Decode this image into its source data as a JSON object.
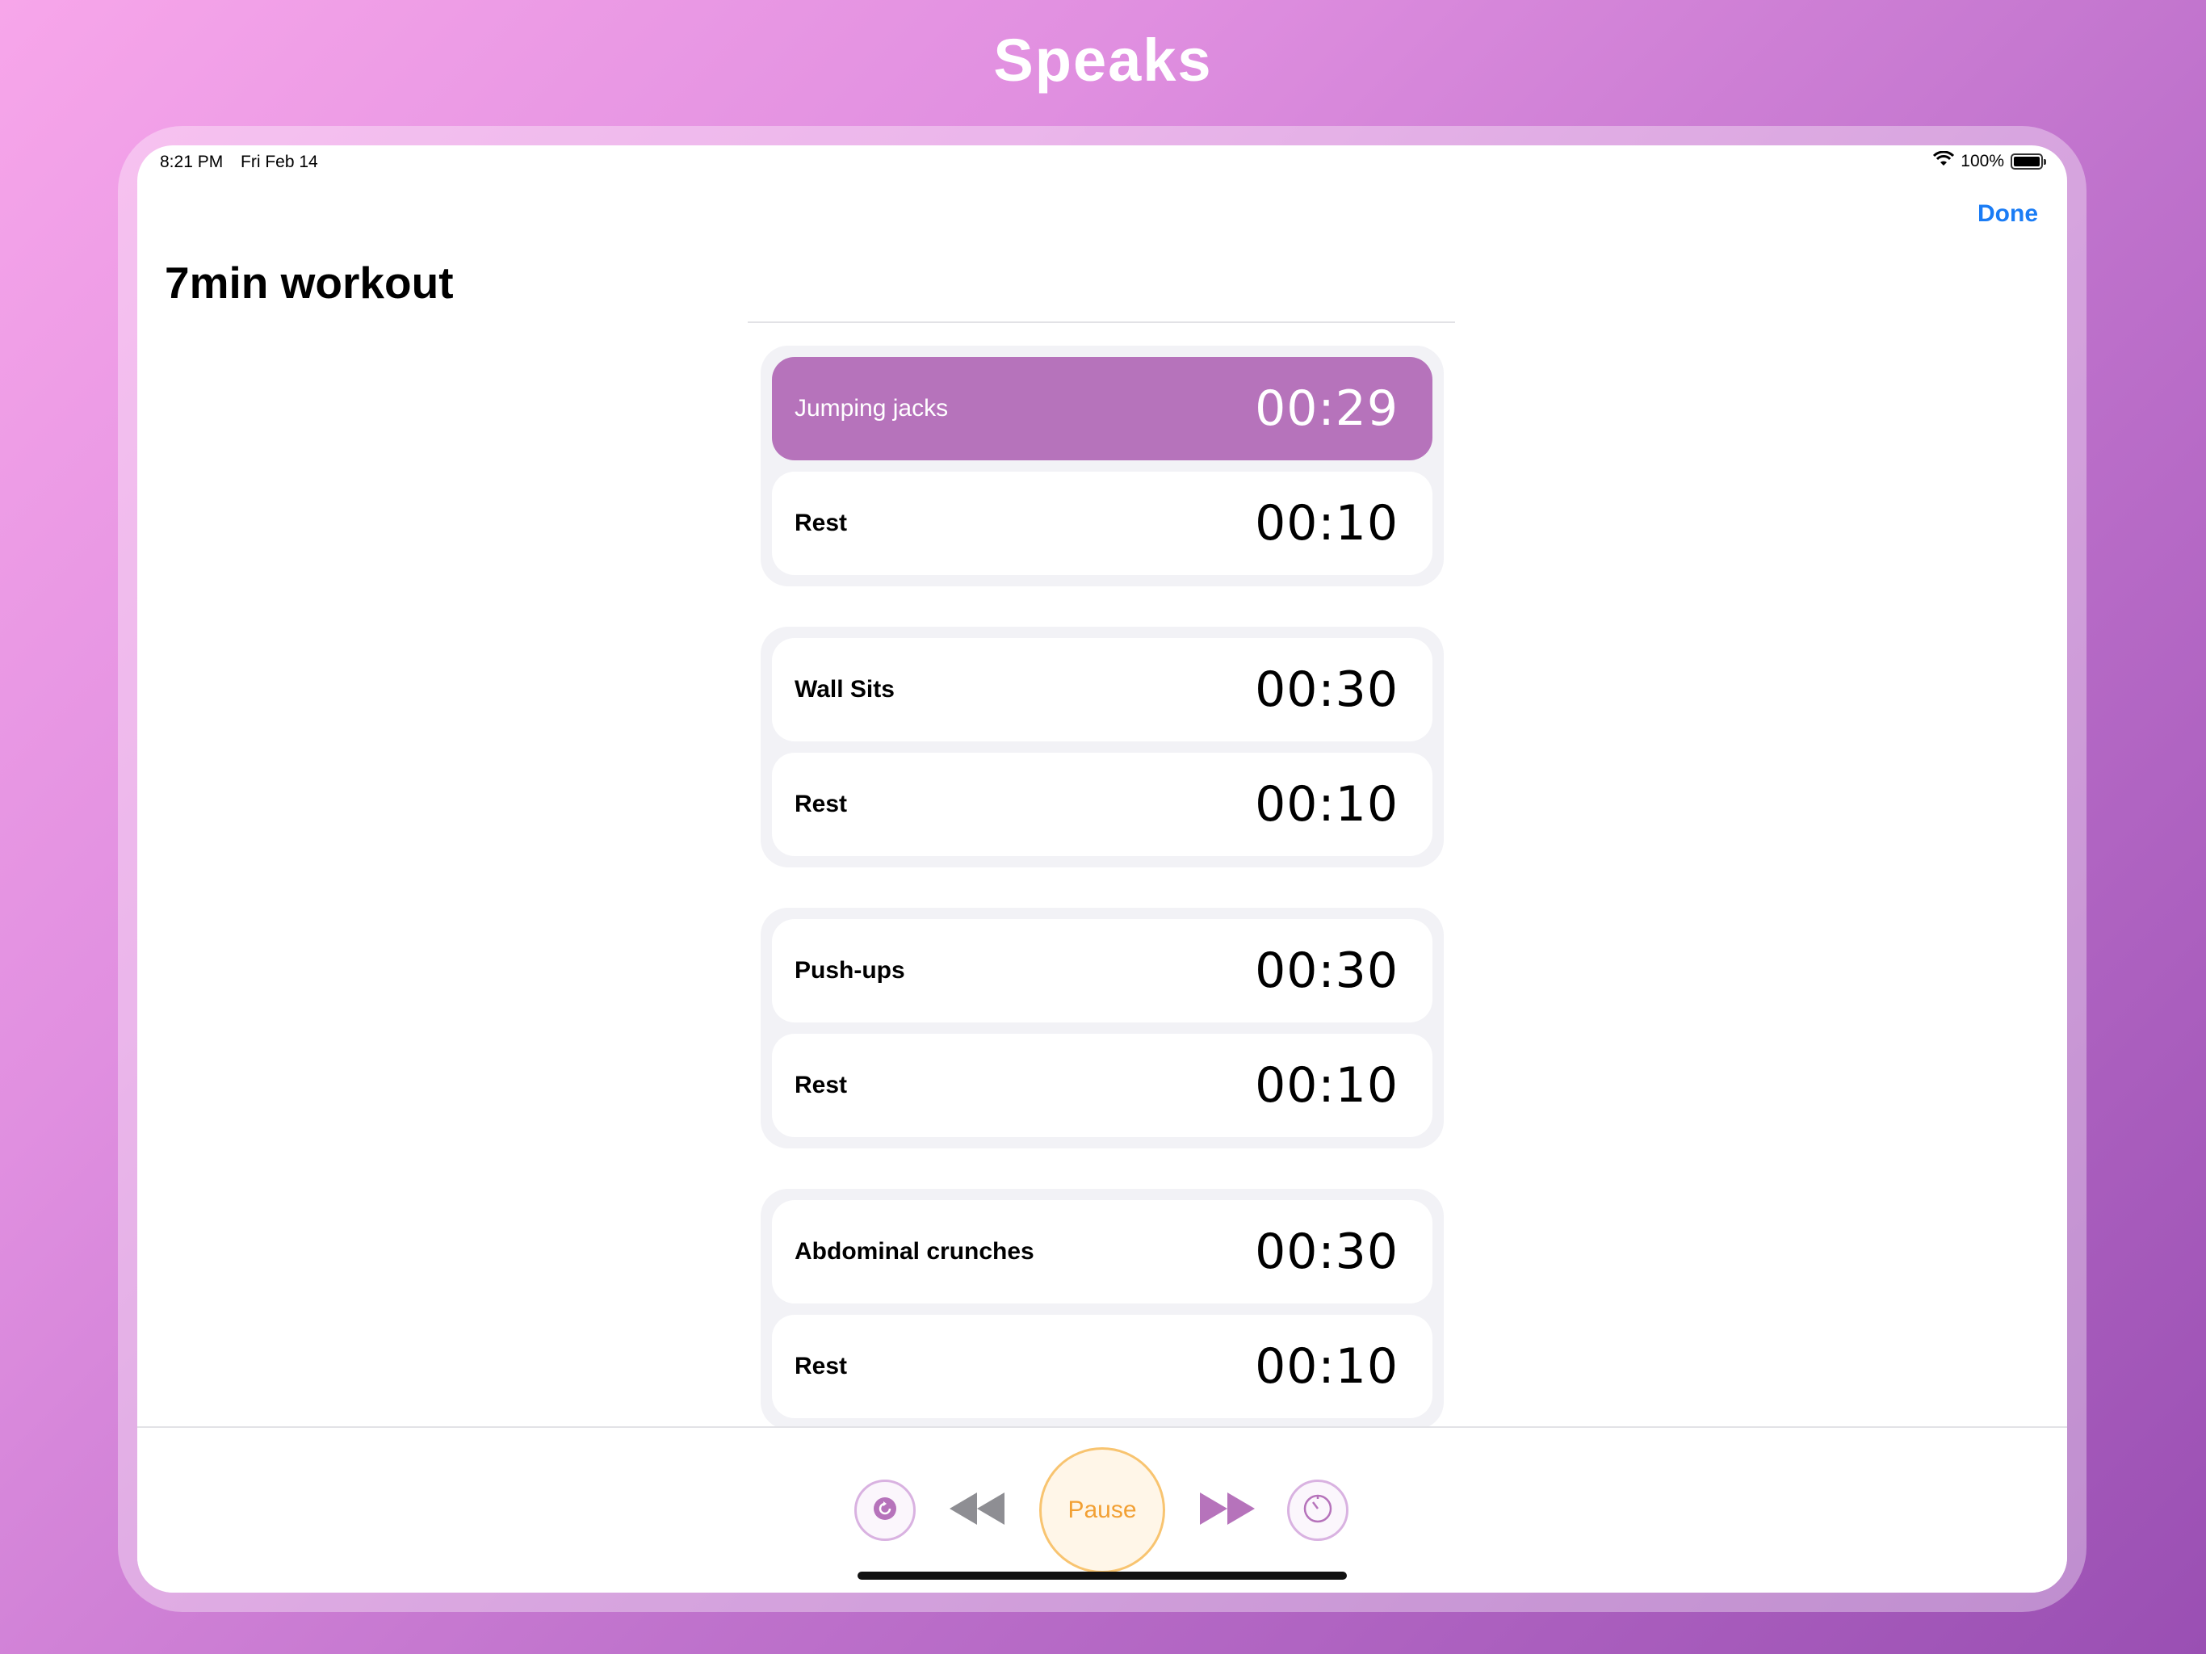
{
  "promo": {
    "title": "Speaks"
  },
  "status_bar": {
    "time": "8:21 PM",
    "date": "Fri Feb 14",
    "battery": "100%",
    "battery_level": 1.0
  },
  "nav": {
    "done_label": "Done",
    "title": "7min workout"
  },
  "groups": [
    {
      "rows": [
        {
          "label": "Jumping jacks",
          "time": "00:29",
          "active": true
        },
        {
          "label": "Rest",
          "time": "00:10"
        }
      ]
    },
    {
      "rows": [
        {
          "label": "Wall Sits",
          "time": "00:30"
        },
        {
          "label": "Rest",
          "time": "00:10"
        }
      ]
    },
    {
      "rows": [
        {
          "label": "Push-ups",
          "time": "00:30"
        },
        {
          "label": "Rest",
          "time": "00:10"
        }
      ]
    },
    {
      "rows": [
        {
          "label": "Abdominal crunches",
          "time": "00:30"
        },
        {
          "label": "Rest",
          "time": "00:10"
        }
      ]
    }
  ],
  "controls": {
    "pause_label": "Pause",
    "icons": [
      "restart-icon",
      "previous-icon",
      "next-icon",
      "timer-icon"
    ]
  },
  "colors": {
    "accent": "#b673bb",
    "link": "#1a7cf5",
    "pause": "#f2a034"
  }
}
